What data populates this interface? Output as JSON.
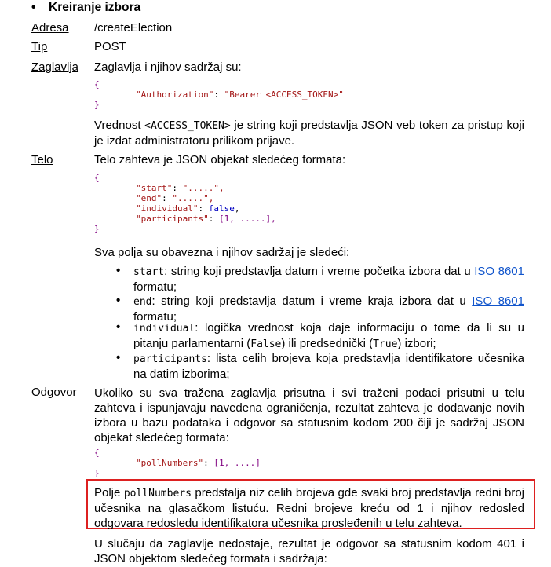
{
  "section": {
    "bullet": "•",
    "title": "Kreiranje izbora"
  },
  "rows": {
    "adresa": {
      "label": "Adresa",
      "value": "/createElection"
    },
    "tip": {
      "label": "Tip",
      "value": "POST"
    },
    "zaglavlja": {
      "label": "Zaglavlja",
      "intro": "Zaglavlja i njihov sadržaj su:"
    },
    "telo": {
      "label": "Telo",
      "intro": "Telo zahteva je JSON objekat sledećeg formata:"
    },
    "odgovor": {
      "label": "Odgovor"
    }
  },
  "header_code": {
    "open": "{",
    "key": "\"Authorization\"",
    "colon": ": ",
    "value_prefix": "\"Bearer ",
    "value_token": "<ACCESS_TOKEN>",
    "value_suffix": "\"",
    "close": "}"
  },
  "token_note": {
    "before": "Vrednost ",
    "token": "<ACCESS_TOKEN>",
    "after": " je string koji predstavlja JSON veb token za pristup koji je izdat administratoru prilikom prijave."
  },
  "body_code": {
    "open": "{",
    "start_key": "\"start\"",
    "start_val": "\".....\",",
    "end_key": "\"end\"",
    "end_val": "\".....\",",
    "individual_key": "\"individual\"",
    "individual_val": "false",
    "individual_comma": ",",
    "participants_key": "\"participants\"",
    "participants_val": "[1, .....],",
    "close": "}"
  },
  "fields_intro": "Sva polja su obavezna i njihov sadržaj je sledeći:",
  "fields": {
    "start": {
      "name": "start",
      "text": ": string koji predstavlja datum i vreme početka izbora dat u ",
      "link": "ISO 8601",
      "text2": "formatu;"
    },
    "end": {
      "name": "end",
      "text": ": string koji predstavlja datum i vreme kraja izbora dat u ",
      "link": "ISO 8601",
      "text2": "formatu;"
    },
    "individual": {
      "name": "individual",
      "text": ": logička vrednost koja daje informaciju o tome da li su u pitanju parlamentarni (",
      "false_word": "False",
      "mid": ") ili predsednički (",
      "true_word": "True",
      "end": ") izbori;"
    },
    "participants": {
      "name": "participants",
      "text": ": lista celih brojeva koja predstavlja identifikatore učesnika na datim izborima;"
    }
  },
  "response_text": "Ukoliko su sva tražena zaglavlja prisutna i svi traženi podaci prisutni u telu zahteva i ispunjavaju navedena ograničenja, rezultat zahteva je dodavanje novih izbora u bazu podataka i odgovor sa statusnim kodom 200 čiji je sadržaj JSON objekat sledećeg formata:",
  "response_code": {
    "open": "{",
    "key": "\"pollNumbers\"",
    "colon": ": ",
    "value": "[1, ....]",
    "close": "}"
  },
  "poll_note": {
    "before": "Polje ",
    "field": "pollNumbers",
    "after": " predstalja niz celih brojeva gde svaki broj predstavlja redni broj učesnika na glasačkom listuću. Redni brojeve kreću od 1 i njihov redosled odgovara redosledu identifikatora učesnika prosleđenih u telu zahteva."
  },
  "missing_header": "U slučaju da zaglavlje nedostaje, rezultat je odgovor sa statusnim kodom 401 i JSON objektom sledećeg formata i sadržaja:",
  "colors": {
    "highlight_border": "#dd2020",
    "link": "#1155cc",
    "code_key": "#a31515",
    "code_bracket": "#800080",
    "code_keyword": "#0000c0"
  }
}
